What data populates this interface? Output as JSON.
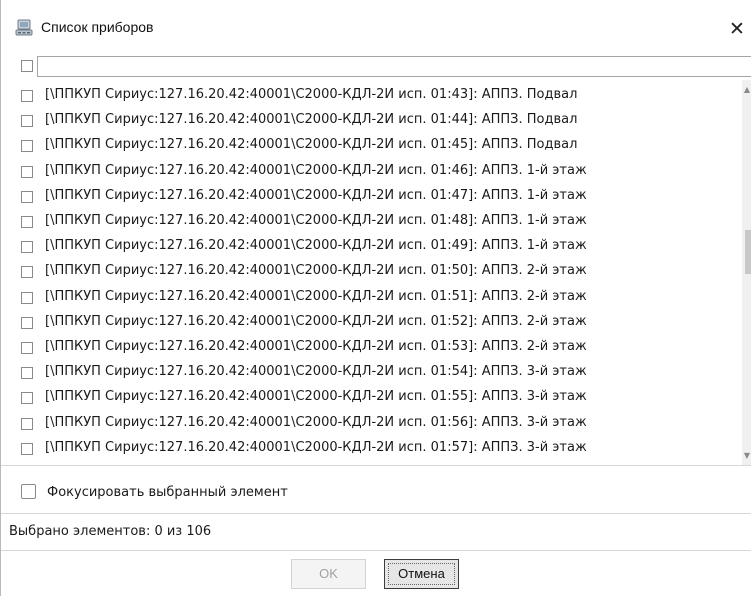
{
  "window": {
    "title": "Список приборов",
    "icon": "device-list-icon",
    "close_glyph": "✕"
  },
  "filter": {
    "value": "",
    "placeholder": ""
  },
  "list": {
    "items": [
      {
        "label": "[\\ППКУП Сириус:127.16.20.42:40001\\С2000-КДЛ-2И исп. 01:43]: АППЗ. Подвал",
        "checked": false
      },
      {
        "label": "[\\ППКУП Сириус:127.16.20.42:40001\\С2000-КДЛ-2И исп. 01:44]: АППЗ. Подвал",
        "checked": false
      },
      {
        "label": "[\\ППКУП Сириус:127.16.20.42:40001\\С2000-КДЛ-2И исп. 01:45]: АППЗ. Подвал",
        "checked": false
      },
      {
        "label": "[\\ППКУП Сириус:127.16.20.42:40001\\С2000-КДЛ-2И исп. 01:46]: АППЗ. 1-й этаж",
        "checked": false
      },
      {
        "label": "[\\ППКУП Сириус:127.16.20.42:40001\\С2000-КДЛ-2И исп. 01:47]: АППЗ. 1-й этаж",
        "checked": false
      },
      {
        "label": "[\\ППКУП Сириус:127.16.20.42:40001\\С2000-КДЛ-2И исп. 01:48]: АППЗ. 1-й этаж",
        "checked": false
      },
      {
        "label": "[\\ППКУП Сириус:127.16.20.42:40001\\С2000-КДЛ-2И исп. 01:49]: АППЗ. 1-й этаж",
        "checked": false
      },
      {
        "label": "[\\ППКУП Сириус:127.16.20.42:40001\\С2000-КДЛ-2И исп. 01:50]: АППЗ. 2-й этаж",
        "checked": false
      },
      {
        "label": "[\\ППКУП Сириус:127.16.20.42:40001\\С2000-КДЛ-2И исп. 01:51]: АППЗ. 2-й этаж",
        "checked": false
      },
      {
        "label": "[\\ППКУП Сириус:127.16.20.42:40001\\С2000-КДЛ-2И исп. 01:52]: АППЗ. 2-й этаж",
        "checked": false
      },
      {
        "label": "[\\ППКУП Сириус:127.16.20.42:40001\\С2000-КДЛ-2И исп. 01:53]: АППЗ. 2-й этаж",
        "checked": false
      },
      {
        "label": "[\\ППКУП Сириус:127.16.20.42:40001\\С2000-КДЛ-2И исп. 01:54]: АППЗ. 3-й этаж",
        "checked": false
      },
      {
        "label": "[\\ППКУП Сириус:127.16.20.42:40001\\С2000-КДЛ-2И исп. 01:55]: АППЗ. 3-й этаж",
        "checked": false
      },
      {
        "label": "[\\ППКУП Сириус:127.16.20.42:40001\\С2000-КДЛ-2И исп. 01:56]: АППЗ. 3-й этаж",
        "checked": false
      },
      {
        "label": "[\\ППКУП Сириус:127.16.20.42:40001\\С2000-КДЛ-2И исп. 01:57]: АППЗ. 3-й этаж",
        "checked": false
      }
    ]
  },
  "focus_option": {
    "label": "Фокусировать выбранный элемент",
    "checked": false
  },
  "status": {
    "text": "Выбрано элементов: 0 из 106"
  },
  "buttons": {
    "ok_label": "OK",
    "ok_enabled": false,
    "cancel_label": "Отмена"
  },
  "colors": {
    "border": "#b9b9b9",
    "separator": "#d7d7d7",
    "disabled_text": "#a0a0a0"
  }
}
